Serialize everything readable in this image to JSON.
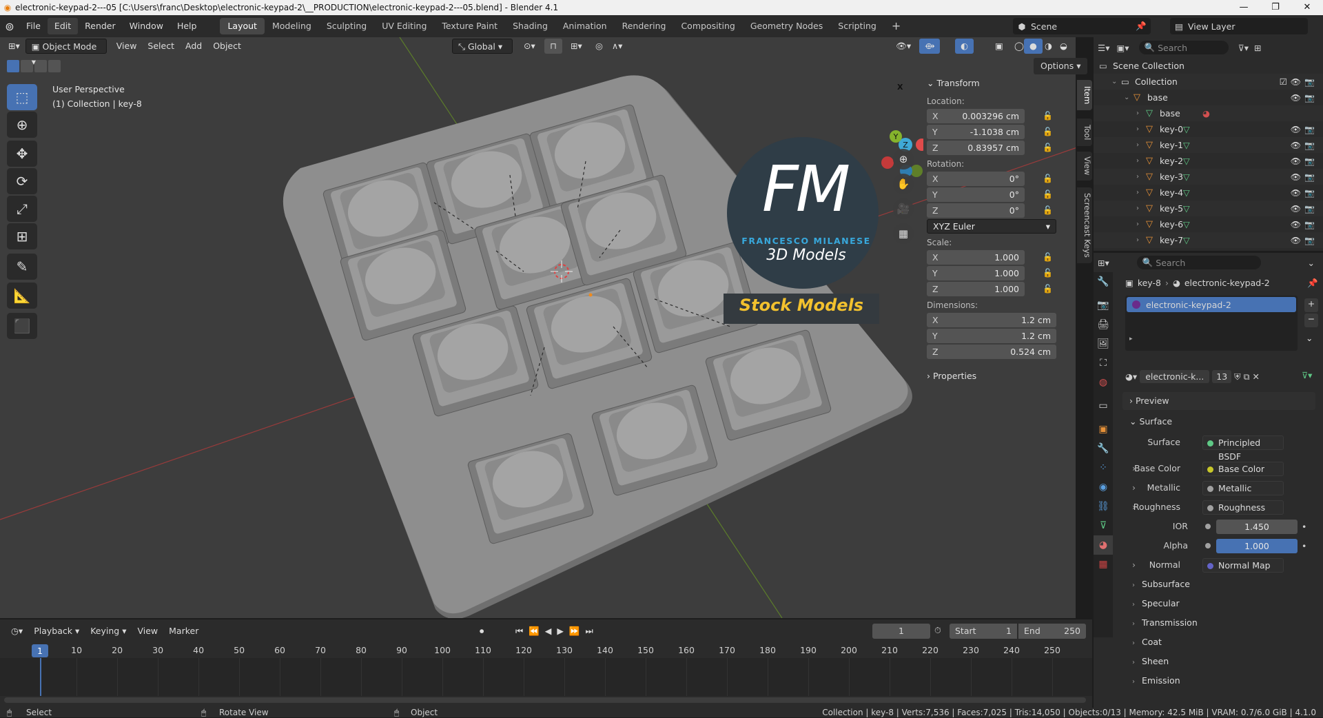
{
  "titlebar": {
    "title": "electronic-keypad-2---05 [C:\\Users\\franc\\Desktop\\electronic-keypad-2\\__PRODUCTION\\electronic-keypad-2---05.blend] - Blender 4.1",
    "minimize": "—",
    "restore": "❐",
    "close": "✕"
  },
  "menu": [
    "File",
    "Edit",
    "Render",
    "Window",
    "Help"
  ],
  "workspaces": [
    "Layout",
    "Modeling",
    "Sculpting",
    "UV Editing",
    "Texture Paint",
    "Shading",
    "Animation",
    "Rendering",
    "Compositing",
    "Geometry Nodes",
    "Scripting"
  ],
  "active_workspace": "Layout",
  "scene": {
    "label": "Scene",
    "view_layer": "View Layer"
  },
  "viewport_header": {
    "mode": "Object Mode",
    "menus": [
      "View",
      "Select",
      "Add",
      "Object"
    ],
    "transform_orientation": "Global",
    "options": "Options"
  },
  "viewport": {
    "perspective": "User Perspective",
    "context": "(1) Collection | key-8",
    "watermark_initials": "FM",
    "watermark_name": "FRANCESCO MILANESE",
    "watermark_sub": "3D Models",
    "watermark_banner": "Stock Models",
    "gizmo_axes": [
      "X",
      "Y",
      "Z"
    ]
  },
  "npanel": {
    "tabs": [
      "Item",
      "Tool",
      "View",
      "Screencast Keys"
    ],
    "transform_title": "Transform",
    "location_label": "Location:",
    "location": [
      {
        "axis": "X",
        "value": "0.003296 cm"
      },
      {
        "axis": "Y",
        "value": "-1.1038 cm"
      },
      {
        "axis": "Z",
        "value": "0.83957 cm"
      }
    ],
    "rotation_label": "Rotation:",
    "rotation": [
      {
        "axis": "X",
        "value": "0°"
      },
      {
        "axis": "Y",
        "value": "0°"
      },
      {
        "axis": "Z",
        "value": "0°"
      }
    ],
    "rotation_mode": "XYZ Euler",
    "scale_label": "Scale:",
    "scale": [
      {
        "axis": "X",
        "value": "1.000"
      },
      {
        "axis": "Y",
        "value": "1.000"
      },
      {
        "axis": "Z",
        "value": "1.000"
      }
    ],
    "dimensions_label": "Dimensions:",
    "dimensions": [
      {
        "axis": "X",
        "value": "1.2 cm"
      },
      {
        "axis": "Y",
        "value": "1.2 cm"
      },
      {
        "axis": "Z",
        "value": "0.524 cm"
      }
    ],
    "properties_title": "Properties"
  },
  "outliner": {
    "search_placeholder": "Search",
    "rows": [
      {
        "label": "Scene Collection",
        "indent": 0,
        "type": "scene"
      },
      {
        "label": "Collection",
        "indent": 1,
        "type": "collection"
      },
      {
        "label": "base",
        "indent": 2,
        "type": "object"
      },
      {
        "label": "base",
        "indent": 3,
        "type": "mesh"
      },
      {
        "label": "key-0",
        "indent": 3,
        "type": "object"
      },
      {
        "label": "key-1",
        "indent": 3,
        "type": "object"
      },
      {
        "label": "key-2",
        "indent": 3,
        "type": "object"
      },
      {
        "label": "key-3",
        "indent": 3,
        "type": "object"
      },
      {
        "label": "key-4",
        "indent": 3,
        "type": "object"
      },
      {
        "label": "key-5",
        "indent": 3,
        "type": "object"
      },
      {
        "label": "key-6",
        "indent": 3,
        "type": "object"
      },
      {
        "label": "key-7",
        "indent": 3,
        "type": "object"
      }
    ]
  },
  "properties": {
    "search_placeholder": "Search",
    "breadcrumb_object": "key-8",
    "breadcrumb_material": "electronic-keypad-2",
    "material_slot": "electronic-keypad-2",
    "material_name": "electronic-k...",
    "users": "13",
    "sections": {
      "preview": "Preview",
      "surface": "Surface"
    },
    "surface_label": "Surface",
    "surface_value": "Principled BSDF",
    "inputs": [
      {
        "label": "Base Color",
        "value": "Base Color",
        "sock": "#c7c729",
        "expand": true
      },
      {
        "label": "Metallic",
        "value": "Metallic",
        "sock": "#a1a1a1",
        "expand": true
      },
      {
        "label": "Roughness",
        "value": "Roughness",
        "sock": "#a1a1a1",
        "expand": true
      }
    ],
    "ior_label": "IOR",
    "ior_value": "1.450",
    "alpha_label": "Alpha",
    "alpha_value": "1.000",
    "normal_label": "Normal",
    "normal_value": "Normal Map",
    "subpanels": [
      "Subsurface",
      "Specular",
      "Transmission",
      "Coat",
      "Sheen",
      "Emission"
    ]
  },
  "timeline": {
    "menus": [
      "Playback",
      "Keying",
      "View",
      "Marker"
    ],
    "current_frame": "1",
    "start_label": "Start",
    "start": "1",
    "end_label": "End",
    "end": "250",
    "ticks": [
      "1",
      "10",
      "20",
      "30",
      "40",
      "50",
      "60",
      "70",
      "80",
      "90",
      "100",
      "110",
      "120",
      "130",
      "140",
      "150",
      "160",
      "170",
      "180",
      "190",
      "200",
      "210",
      "220",
      "230",
      "240",
      "250"
    ]
  },
  "statusbar": {
    "select": "Select",
    "rotate": "Rotate View",
    "object": "Object",
    "stats": "Collection | key-8 | Verts:7,536 | Faces:7,025 | Tris:14,050 | Objects:0/13 | Memory: 42.5 MiB | VRAM: 0.7/6.0 GiB | 4.1.0"
  },
  "colors": {
    "accent": "#4772b3",
    "object_orange": "#e69138",
    "mesh_green": "#5fc986"
  }
}
